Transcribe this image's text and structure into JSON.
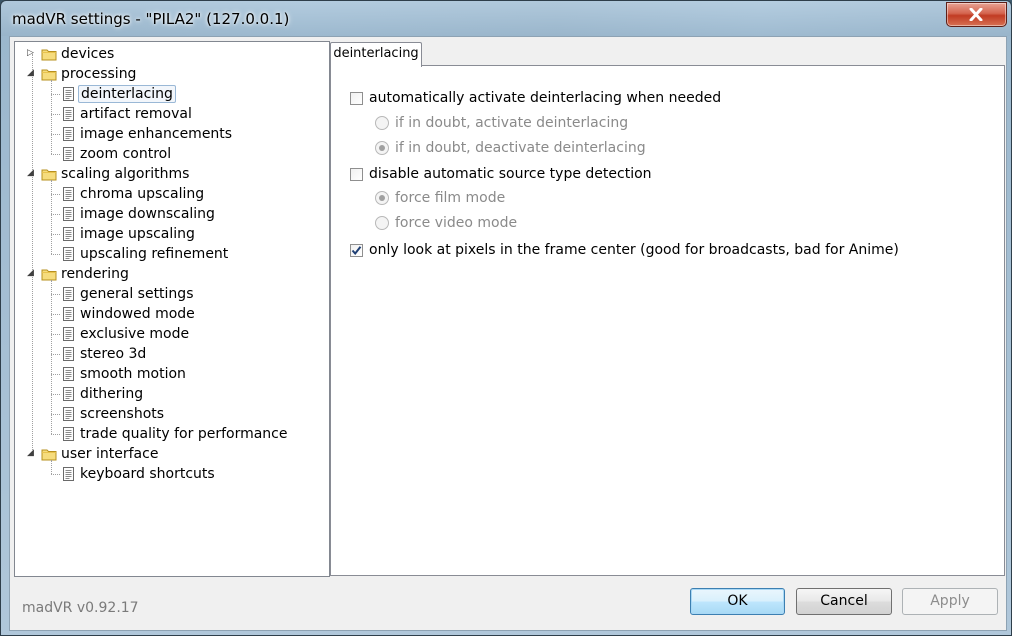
{
  "window": {
    "title": "madVR settings - \"PILA2\" (127.0.0.1)"
  },
  "tree": {
    "items": [
      {
        "label": "devices",
        "type": "folder",
        "level": 0,
        "expander": "collapsed"
      },
      {
        "label": "processing",
        "type": "folder",
        "level": 0,
        "expander": "expanded"
      },
      {
        "label": "deinterlacing",
        "type": "page",
        "level": 1,
        "selected": true
      },
      {
        "label": "artifact removal",
        "type": "page",
        "level": 1
      },
      {
        "label": "image enhancements",
        "type": "page",
        "level": 1
      },
      {
        "label": "zoom control",
        "type": "page",
        "level": 1
      },
      {
        "label": "scaling algorithms",
        "type": "folder",
        "level": 0,
        "expander": "expanded"
      },
      {
        "label": "chroma upscaling",
        "type": "page",
        "level": 1
      },
      {
        "label": "image downscaling",
        "type": "page",
        "level": 1
      },
      {
        "label": "image upscaling",
        "type": "page",
        "level": 1
      },
      {
        "label": "upscaling refinement",
        "type": "page",
        "level": 1
      },
      {
        "label": "rendering",
        "type": "folder",
        "level": 0,
        "expander": "expanded"
      },
      {
        "label": "general settings",
        "type": "page",
        "level": 1
      },
      {
        "label": "windowed mode",
        "type": "page",
        "level": 1
      },
      {
        "label": "exclusive mode",
        "type": "page",
        "level": 1
      },
      {
        "label": "stereo 3d",
        "type": "page",
        "level": 1
      },
      {
        "label": "smooth motion",
        "type": "page",
        "level": 1
      },
      {
        "label": "dithering",
        "type": "page",
        "level": 1
      },
      {
        "label": "screenshots",
        "type": "page",
        "level": 1
      },
      {
        "label": "trade quality for performance",
        "type": "page",
        "level": 1
      },
      {
        "label": "user interface",
        "type": "folder",
        "level": 0,
        "expander": "expanded"
      },
      {
        "label": "keyboard shortcuts",
        "type": "page",
        "level": 1
      }
    ]
  },
  "version": "madVR v0.92.17",
  "tab": {
    "label": "deinterlacing"
  },
  "options": {
    "auto_deinterlace": {
      "label": "automatically activate deinterlacing when needed",
      "checked": false
    },
    "doubt_activate": {
      "label": "if in doubt, activate deinterlacing",
      "selected": false,
      "enabled": false
    },
    "doubt_deactivate": {
      "label": "if in doubt, deactivate deinterlacing",
      "selected": true,
      "enabled": false
    },
    "disable_detection": {
      "label": "disable automatic source type detection",
      "checked": false
    },
    "force_film": {
      "label": "force film mode",
      "selected": true,
      "enabled": false
    },
    "force_video": {
      "label": "force video mode",
      "selected": false,
      "enabled": false
    },
    "frame_center": {
      "label": "only look at pixels in the frame center  (good for broadcasts, bad for Anime)",
      "checked": true
    }
  },
  "buttons": {
    "ok": "OK",
    "cancel": "Cancel",
    "apply": "Apply"
  },
  "colors": {
    "accent": "#3c7fb1",
    "close": "#c13b23",
    "selection": "#9ab8d6"
  }
}
